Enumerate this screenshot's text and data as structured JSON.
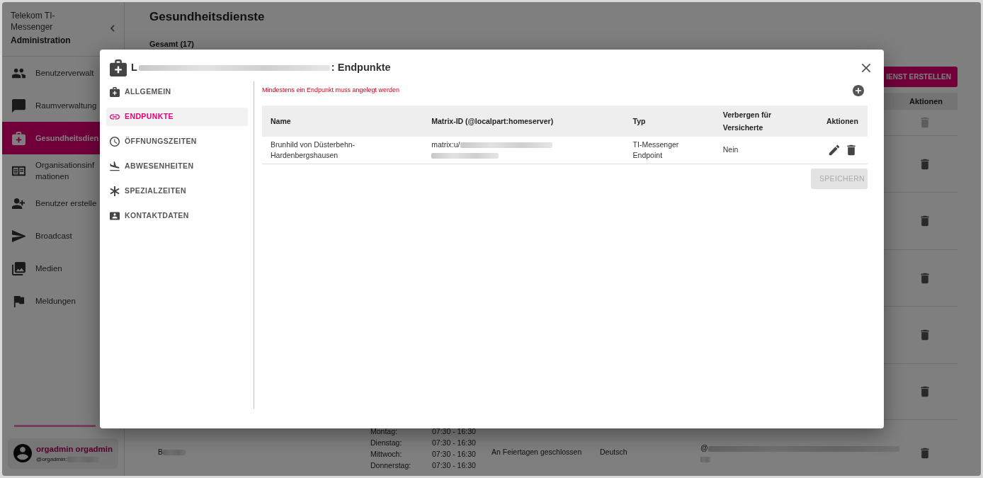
{
  "sidebar": {
    "brand": "Telekom TI-Messenger",
    "subtitle": "Administration",
    "items": [
      {
        "label": "Benutzerverwalt",
        "selected": false
      },
      {
        "label": "Raumverwaltung",
        "selected": false
      },
      {
        "label": "Gesundheitsdien",
        "selected": true
      },
      {
        "label": "Organisationsinf\nmationen",
        "selected": false
      },
      {
        "label": "Benutzer erstelle",
        "selected": false
      },
      {
        "label": "Broadcast",
        "selected": false
      },
      {
        "label": "Medien",
        "selected": false
      },
      {
        "label": "Meldungen",
        "selected": false
      }
    ],
    "user": {
      "name": "orgadmin orgadmin",
      "handle": "@orgadmin:"
    }
  },
  "main": {
    "title": "Gesundheitsdienste",
    "total": "Gesamt (17)",
    "create_button": "IENST ERSTELLEN",
    "table": {
      "columns": [
        "Aktionen"
      ],
      "rows": [
        {
          "delete_disabled": true
        },
        {
          "delete_disabled": false
        },
        {
          "delete_disabled": false
        },
        {
          "delete_disabled": false
        },
        {
          "delete_disabled": false
        },
        {
          "delete_disabled": false
        },
        {
          "delete_disabled": false,
          "name": "B",
          "hours": [
            {
              "day": "Montag:",
              "time": "07:30 - 16:30"
            },
            {
              "day": "Dienstag:",
              "time": "07:30 - 16:30"
            },
            {
              "day": "Mittwoch:",
              "time": "07:30 - 16:30"
            },
            {
              "day": "Donnerstag:",
              "time": "07:30 - 16:30"
            }
          ],
          "holidays": "An Feiertagen geschlossen",
          "language": "Deutsch",
          "matrix_id": "@"
        }
      ]
    }
  },
  "dialog": {
    "title_start": "L",
    "title_end": ": Endpunkte",
    "nav": [
      {
        "label": "ALLGEMEIN",
        "selected": false
      },
      {
        "label": "ENDPUNKTE",
        "selected": true
      },
      {
        "label": "ÖFFNUNGSZEITEN",
        "selected": false
      },
      {
        "label": "ABWESENHEITEN",
        "selected": false
      },
      {
        "label": "SPEZIALZEITEN",
        "selected": false
      },
      {
        "label": "KONTAKTDATEN",
        "selected": false
      }
    ],
    "error": "Mindestens ein Endpunkt muss angelegt werden",
    "table": {
      "columns": [
        "Name",
        "Matrix-ID (@localpart:homeserver)",
        "Typ",
        "Verbergen für Versicherte",
        "Aktionen"
      ],
      "rows": [
        {
          "name": "Brunhild von Düsterbehn-Hardenbergshausen",
          "matrix_id": "matrix:u/",
          "type": "TI-Messenger Endpoint",
          "hidden": "Nein"
        }
      ]
    },
    "save_button": {
      "label": "SPEICHERN",
      "disabled": true
    }
  }
}
